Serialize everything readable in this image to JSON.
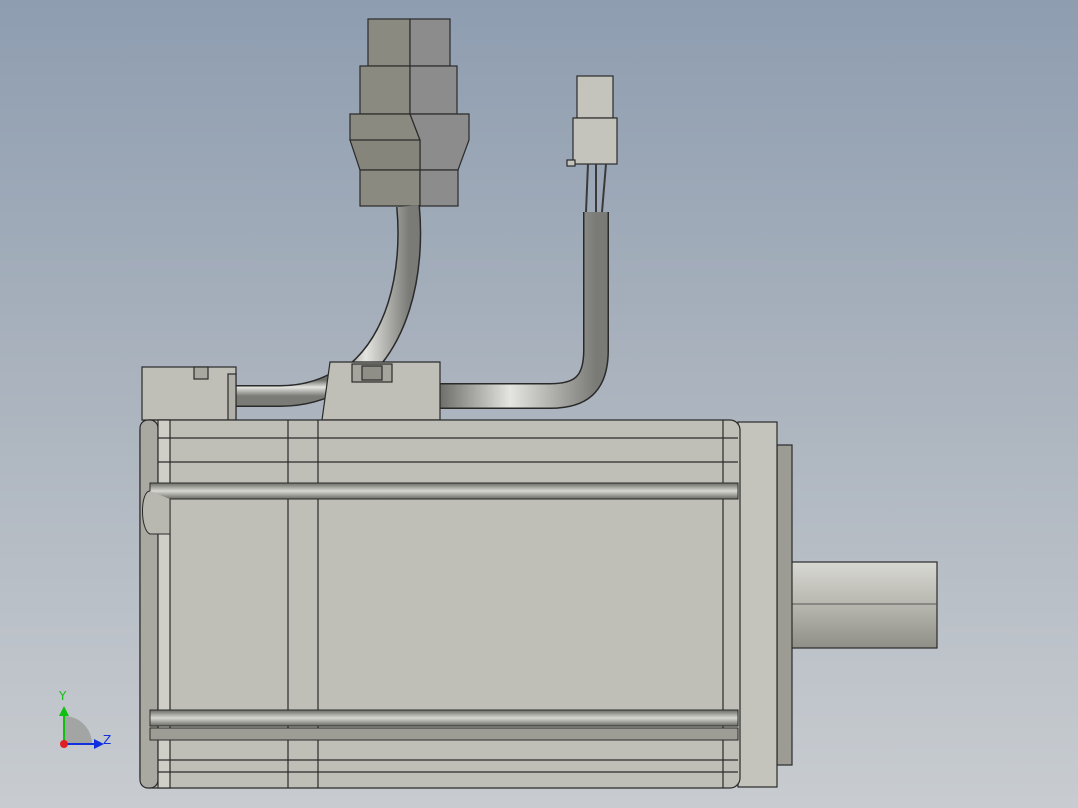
{
  "viewport": {
    "background_top": "#8e9db0",
    "background_bottom": "#c8ccd0"
  },
  "model": {
    "body_color": "#bfbfb8",
    "edge_color": "#2a2a2a",
    "connector_dark": "#8a8a80",
    "connector_light": "#8c8c8c",
    "cable_color": "#b8b8b4"
  },
  "triad": {
    "y_label": "Y",
    "z_label": "Z",
    "y_color": "#10c010",
    "z_color": "#1030e0",
    "x_color": "#e02020"
  }
}
